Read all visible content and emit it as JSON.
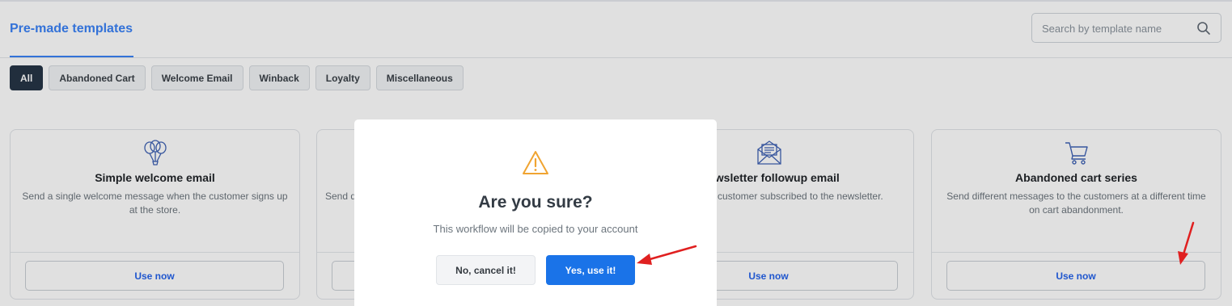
{
  "header": {
    "title": "Pre-made templates",
    "search_placeholder": "Search by template name"
  },
  "filters": [
    {
      "label": "All",
      "active": true
    },
    {
      "label": "Abandoned Cart",
      "active": false
    },
    {
      "label": "Welcome Email",
      "active": false
    },
    {
      "label": "Winback",
      "active": false
    },
    {
      "label": "Loyalty",
      "active": false
    },
    {
      "label": "Miscellaneous",
      "active": false
    }
  ],
  "cards": [
    {
      "title": "Simple welcome email",
      "description": "Send a single welcome message when the customer signs up at the store.",
      "button": "Use now",
      "icon": "balloons-icon"
    },
    {
      "title": "",
      "description": "Send d",
      "button": "",
      "icon": ""
    },
    {
      "title": "ewsletter followup email",
      "description": "customer subscribed to the newsletter.",
      "button": "Use now",
      "icon": "envelope-icon"
    },
    {
      "title": "Abandoned cart series",
      "description": "Send different messages to the customers at a different time on cart abandonment.",
      "button": "Use now",
      "icon": "cart-icon"
    }
  ],
  "modal": {
    "icon": "warning-icon",
    "title": "Are you sure?",
    "text": "This workflow will be copied to your account",
    "cancel_label": "No, cancel it!",
    "confirm_label": "Yes, use it!"
  },
  "colors": {
    "accent": "#3b82f6",
    "confirm": "#1a73e8",
    "warning": "#f0a431",
    "annotation_arrow": "#e02020",
    "active_chip": "#263546"
  }
}
